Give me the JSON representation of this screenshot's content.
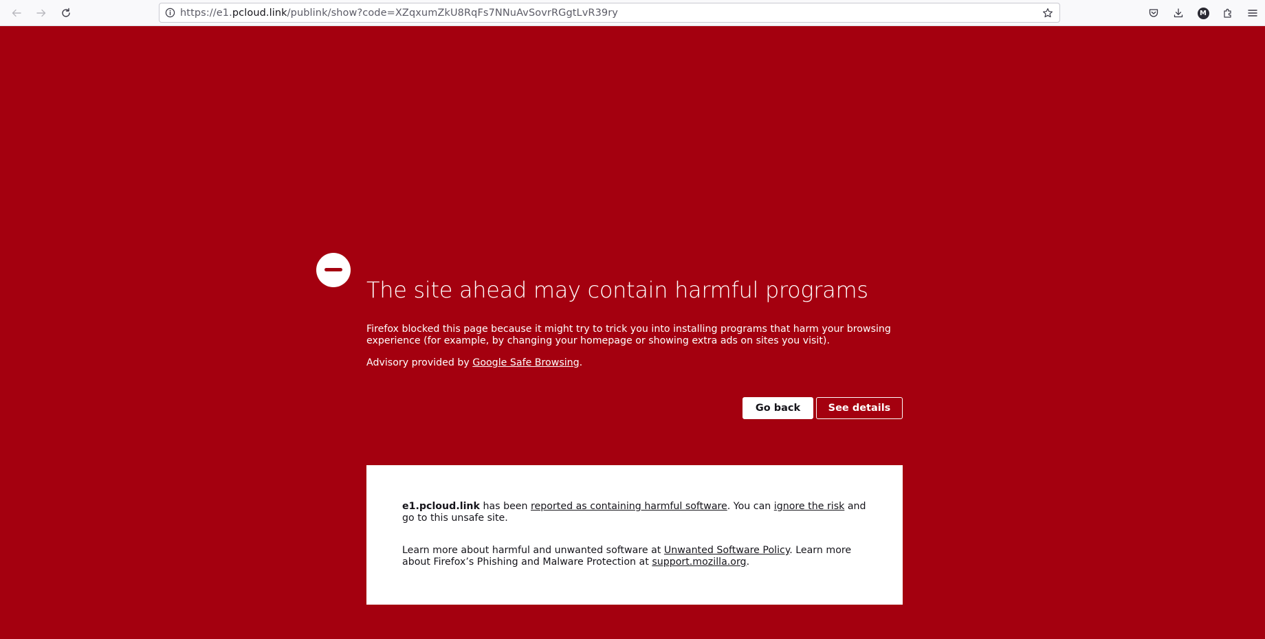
{
  "browser": {
    "url": {
      "prefix": "https://e1.",
      "host": "pcloud.link",
      "path": "/publink/show?code=XZqxumZkU8RqFs7NNuAvSovrRGgtLvR39ry"
    },
    "account_initial": "M",
    "icons": {
      "back": "arrow-left-icon",
      "forward": "arrow-right-icon",
      "reload": "reload-icon",
      "site_info": "info-circle-icon",
      "bookmark": "star-icon",
      "pocket": "pocket-icon",
      "downloads": "download-icon",
      "extensions": "puzzle-icon",
      "menu": "hamburger-menu-icon"
    }
  },
  "warning": {
    "title": "The site ahead may contain harmful programs",
    "description": "Firefox blocked this page because it might try to trick you into installing programs that harm your browsing experience (for example, by changing your homepage or showing extra ads on sites you visit).",
    "advisory_prefix": "Advisory provided by ",
    "advisory_link": "Google Safe Browsing",
    "advisory_suffix": ".",
    "go_back_label": "Go back",
    "see_details_label": "See details"
  },
  "details": {
    "site": "e1.pcloud.link",
    "text1": " has been ",
    "link_reported": "reported as containing harmful software",
    "text2": ". You can ",
    "link_ignore": "ignore the risk",
    "text3": " and go to this unsafe site.",
    "learn_prefix": "Learn more about harmful and unwanted software at ",
    "link_policy": "Unwanted Software Policy",
    "learn_middle": ". Learn more about Firefox’s Phishing and Malware Protection at ",
    "link_support": "support.mozilla.org",
    "learn_suffix": "."
  },
  "colors": {
    "page_background": "#a4000f",
    "toolbar_background": "#f9f9fb",
    "text_on_red": "#ffffff"
  }
}
